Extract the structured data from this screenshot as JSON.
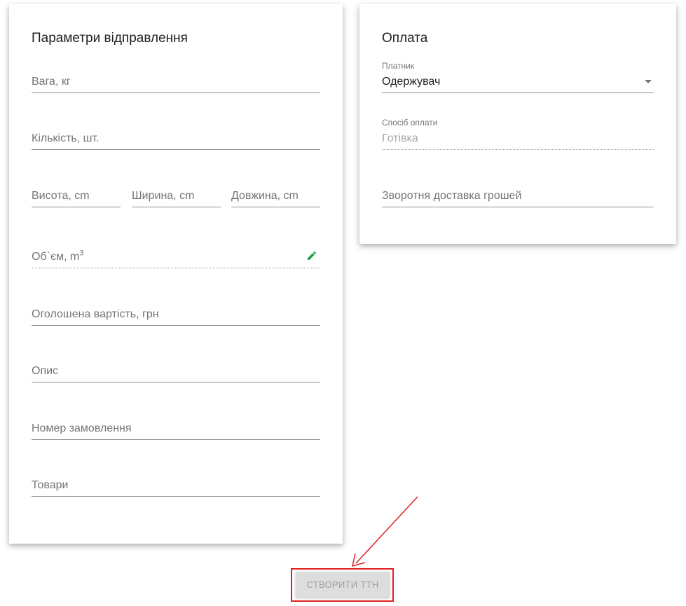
{
  "params_card": {
    "title": "Параметри відправлення",
    "weight_placeholder": "Вага, кг",
    "quantity_placeholder": "Кількість, шт.",
    "height_placeholder": "Висота, cm",
    "width_placeholder": "Ширина, cm",
    "length_placeholder": "Довжина, cm",
    "volume_label": "Об`єм, m",
    "volume_sup": "3",
    "declared_value_placeholder": "Оголошена вартість, грн",
    "description_placeholder": "Опис",
    "order_number_placeholder": "Номер замовлення",
    "goods_placeholder": "Товари",
    "edit_icon": "pencil-icon",
    "edit_icon_color": "#1e9e4a"
  },
  "payment_card": {
    "title": "Оплата",
    "payer_label": "Платник",
    "payer_value": "Одержувач",
    "payment_method_label": "Спосіб оплати",
    "payment_method_value": "Готівка",
    "cod_placeholder": "Зворотня доставка грошей"
  },
  "actions": {
    "create_button_label": "СТВОРИТИ ТТН",
    "highlight_color": "#e02020"
  }
}
